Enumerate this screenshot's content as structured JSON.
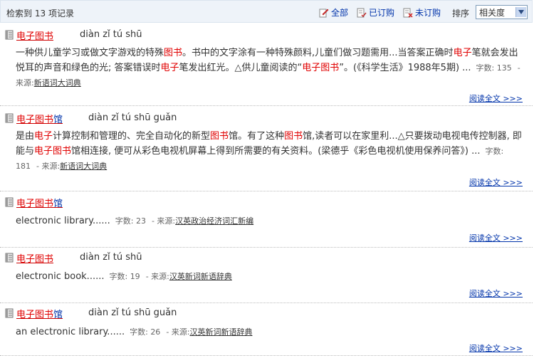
{
  "toolbar": {
    "count_prefix": "检索到",
    "count_value": "13",
    "count_suffix": "项记录",
    "filters": [
      {
        "label": "全部",
        "icon": "edit-icon"
      },
      {
        "label": "已订购",
        "icon": "subscribed-icon"
      },
      {
        "label": "未订购",
        "icon": "unsubscribed-icon"
      }
    ],
    "sort_label": "排序",
    "sort_value": "相关度"
  },
  "entries": [
    {
      "title_parts": [
        {
          "t": "电子图书",
          "h": true
        }
      ],
      "pinyin": "diàn zǐ tú shū",
      "body_segments": [
        {
          "t": "一种供儿童学习或做文字游戏的特殊"
        },
        {
          "t": "图书",
          "h": true
        },
        {
          "t": "。书中的文字涂有一种特殊颜料,儿童们做习题需用...当答案正确时"
        },
        {
          "t": "电子",
          "h": true
        },
        {
          "t": "笔就会发出悦耳的声音和绿色的光; 答案错误时"
        },
        {
          "t": "电子",
          "h": true
        },
        {
          "t": "笔发出红光。△供儿童阅读的“"
        },
        {
          "t": "电子图书",
          "h": true
        },
        {
          "t": "”。(《科学生活》1988年5期) ..."
        }
      ],
      "word_count_label": "字数:",
      "word_count": "135",
      "source_label": "- 来源:",
      "source": "新语词大词典",
      "read_more": "阅读全文 >>>"
    },
    {
      "title_parts": [
        {
          "t": "电子图书",
          "h": true
        },
        {
          "t": "馆",
          "h": false
        }
      ],
      "pinyin": "diàn zǐ tú shū guǎn",
      "body_segments": [
        {
          "t": "是由"
        },
        {
          "t": "电子",
          "h": true
        },
        {
          "t": "计算控制和管理的、完全自动化的新型"
        },
        {
          "t": "图书",
          "h": true
        },
        {
          "t": "馆。有了这种"
        },
        {
          "t": "图书",
          "h": true
        },
        {
          "t": "馆,读者可以在家里利...△只要拨动电视电传控制器, 即能与"
        },
        {
          "t": "电子图书",
          "h": true
        },
        {
          "t": "馆相连接, 便可从彩色电视机屏幕上得到所需要的有关资料。(梁德乎《彩色电视机使用保养问答》) ..."
        }
      ],
      "word_count_label": "字数:",
      "word_count": "181",
      "source_label": "- 来源:",
      "source": "新语词大词典",
      "read_more": "阅读全文 >>>"
    },
    {
      "title_parts": [
        {
          "t": "电子图书",
          "h": true
        },
        {
          "t": "馆",
          "h": false
        }
      ],
      "pinyin": "",
      "body_segments": [
        {
          "t": "electronic library......"
        }
      ],
      "word_count_label": "字数:",
      "word_count": "23",
      "source_label": "- 来源:",
      "source": "汉英政治经济词汇新编",
      "read_more": "阅读全文 >>>"
    },
    {
      "title_parts": [
        {
          "t": "电子图书",
          "h": true
        }
      ],
      "pinyin": "diàn zǐ tú shū",
      "body_segments": [
        {
          "t": "electronic book......"
        }
      ],
      "word_count_label": "字数:",
      "word_count": "19",
      "source_label": "- 来源:",
      "source": "汉英新词新语辞典",
      "read_more": "阅读全文 >>>"
    },
    {
      "title_parts": [
        {
          "t": "电子图书",
          "h": true
        },
        {
          "t": "馆",
          "h": false
        }
      ],
      "pinyin": "diàn zǐ tú shū guǎn",
      "body_segments": [
        {
          "t": "an electronic library......"
        }
      ],
      "word_count_label": "字数:",
      "word_count": "26",
      "source_label": "- 来源:",
      "source": "汉英新词新语辞典",
      "read_more": "阅读全文 >>>"
    }
  ]
}
